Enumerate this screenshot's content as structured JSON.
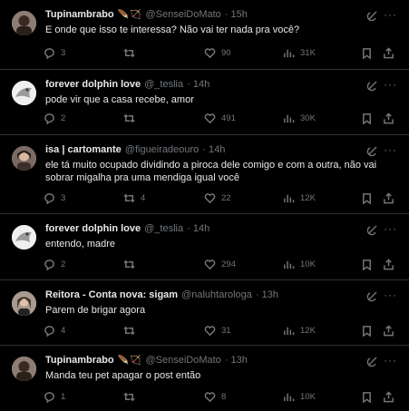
{
  "tweets": [
    {
      "name": "Tupinambrabo",
      "emoji": "🪶🏹",
      "handle": "@SenseiDoMato",
      "time": "· 15h",
      "text": "E onde que isso te interessa? Não vai ter nada pra você?",
      "replies": "3",
      "retweets": "",
      "likes": "90",
      "views": "31K",
      "avatar_color": "#6b5e57"
    },
    {
      "name": "forever dolphin love",
      "emoji": "",
      "handle": "@_teslia",
      "time": "· 14h",
      "text": "pode vir que a casa recebe, amor",
      "replies": "2",
      "retweets": "",
      "likes": "491",
      "views": "30K",
      "avatar_color": "#e6e6e6"
    },
    {
      "name": "isa | cartomante",
      "emoji": "",
      "handle": "@figueiradeouro",
      "time": "· 14h",
      "text": "ele tá muito ocupado dividindo a piroca dele comigo e com a outra, não vai sobrar migalha pra uma mendiga igual você",
      "replies": "3",
      "retweets": "4",
      "likes": "22",
      "views": "12K",
      "avatar_color": "#5a4b45"
    },
    {
      "name": "forever dolphin love",
      "emoji": "",
      "handle": "@_teslia",
      "time": "· 14h",
      "text": "entendo, madre",
      "replies": "2",
      "retweets": "",
      "likes": "294",
      "views": "10K",
      "avatar_color": "#e6e6e6"
    },
    {
      "name": "Reitora - Conta nova: sigam",
      "emoji": "",
      "handle": "@naluhtarologa",
      "time": "· 13h",
      "text": "Parem de brigar agora",
      "replies": "4",
      "retweets": "",
      "likes": "31",
      "views": "12K",
      "avatar_color": "#8a7a70"
    },
    {
      "name": "Tupinambrabo",
      "emoji": "🪶🏹",
      "handle": "@SenseiDoMato",
      "time": "· 13h",
      "text": "Manda teu pet apagar o post então",
      "replies": "1",
      "retweets": "",
      "likes": "8",
      "views": "10K",
      "avatar_color": "#6b5e57"
    }
  ],
  "icons": {
    "reply": "reply-icon",
    "retweet": "retweet-icon",
    "like": "heart-icon",
    "views": "views-icon",
    "bookmark": "bookmark-icon",
    "share": "share-icon",
    "grok": "grok-icon",
    "more": "more-icon"
  },
  "colors": {
    "background": "#000000",
    "text": "#e7e9ea",
    "muted": "#71767b",
    "divider": "#2f3336"
  }
}
